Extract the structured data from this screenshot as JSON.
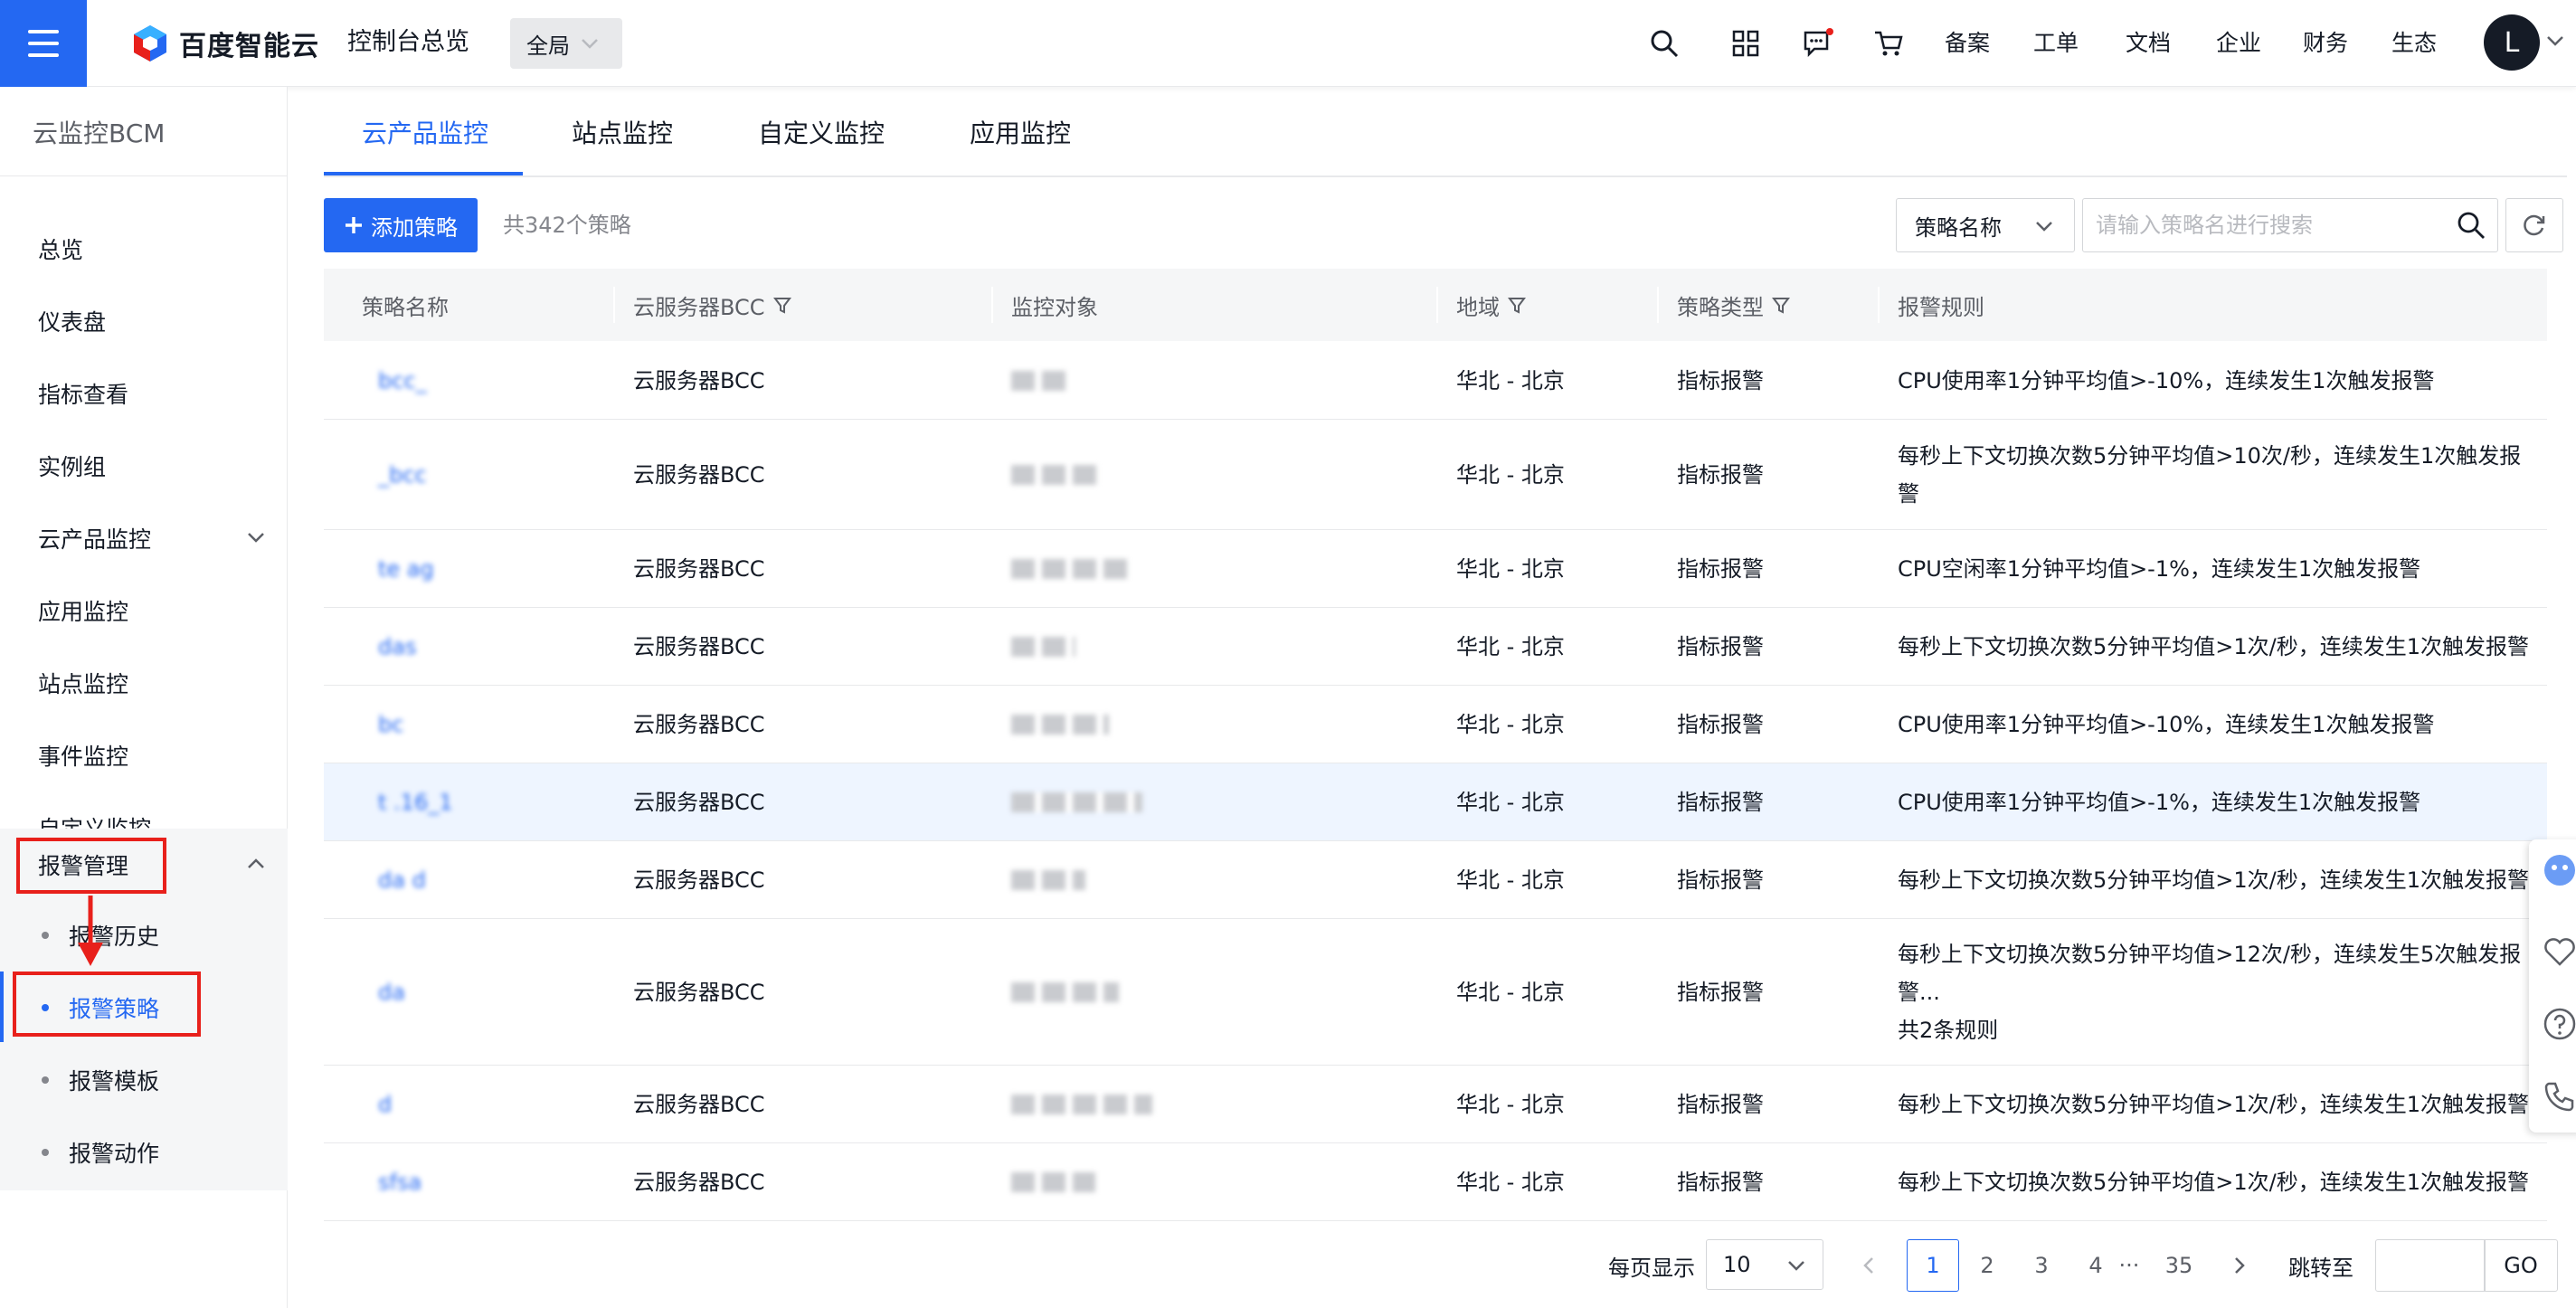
{
  "topbar": {
    "logo_text": "百度智能云",
    "console_title": "控制台总览",
    "region": "全局",
    "links": [
      "备案",
      "工单",
      "文档",
      "企业",
      "财务",
      "生态"
    ],
    "avatar_letter": "L",
    "icons": [
      "search-icon",
      "apps-icon",
      "message-icon",
      "cart-icon"
    ]
  },
  "sidebar": {
    "title": "云监控BCM",
    "items": [
      {
        "label": "总览"
      },
      {
        "label": "仪表盘"
      },
      {
        "label": "指标查看"
      },
      {
        "label": "实例组"
      },
      {
        "label": "云产品监控"
      },
      {
        "label": "应用监控"
      },
      {
        "label": "站点监控"
      },
      {
        "label": "事件监控"
      },
      {
        "label": "自定义监控"
      },
      {
        "label": "报警管理"
      }
    ],
    "subitems": [
      {
        "label": "报警历史"
      },
      {
        "label": "报警策略"
      },
      {
        "label": "报警模板"
      },
      {
        "label": "报警动作"
      }
    ]
  },
  "tabs": [
    "云产品监控",
    "站点监控",
    "自定义监控",
    "应用监控"
  ],
  "toolbar": {
    "add_label": "添加策略",
    "count_text": "共342个策略",
    "filter_label": "策略名称",
    "search_placeholder": "请输入策略名进行搜索"
  },
  "table": {
    "headers": [
      "策略名称",
      "云服务器BCC",
      "监控对象",
      "地域",
      "策略类型",
      "报警规则"
    ],
    "rows": [
      {
        "name": "bcc_",
        "service": "云服务器BCC",
        "object": "",
        "region": "华北 - 北京",
        "type": "指标报警",
        "rule": "CPU使用率1分钟平均值>-10%，连续发生1次触发报警",
        "rule2": "",
        "rule3": ""
      },
      {
        "name": "_bcc",
        "service": "云服务器BCC",
        "object": "",
        "region": "华北 - 北京",
        "type": "指标报警",
        "rule": "每秒上下文切换次数5分钟平均值>10次/秒，连续发生1次触发报",
        "rule2": "警",
        "rule3": ""
      },
      {
        "name": "te ag",
        "service": "云服务器BCC",
        "object": "",
        "region": "华北 - 北京",
        "type": "指标报警",
        "rule": "CPU空闲率1分钟平均值>-1%，连续发生1次触发报警",
        "rule2": "",
        "rule3": ""
      },
      {
        "name": "das",
        "service": "云服务器BCC",
        "object": "",
        "region": "华北 - 北京",
        "type": "指标报警",
        "rule": "每秒上下文切换次数5分钟平均值>1次/秒，连续发生1次触发报警",
        "rule2": "",
        "rule3": ""
      },
      {
        "name": "bc",
        "service": "云服务器BCC",
        "object": "",
        "region": "华北 - 北京",
        "type": "指标报警",
        "rule": "CPU使用率1分钟平均值>-10%，连续发生1次触发报警",
        "rule2": "",
        "rule3": ""
      },
      {
        "name": "t .16_1",
        "service": "云服务器BCC",
        "object": "",
        "region": "华北 - 北京",
        "type": "指标报警",
        "rule": "CPU使用率1分钟平均值>-1%，连续发生1次触发报警",
        "rule2": "",
        "rule3": ""
      },
      {
        "name": "da d",
        "service": "云服务器BCC",
        "object": "",
        "region": "华北 - 北京",
        "type": "指标报警",
        "rule": "每秒上下文切换次数5分钟平均值>1次/秒，连续发生1次触发报警",
        "rule2": "",
        "rule3": ""
      },
      {
        "name": "da",
        "service": "云服务器BCC",
        "object": "",
        "region": "华北 - 北京",
        "type": "指标报警",
        "rule": "每秒上下文切换次数5分钟平均值>12次/秒，连续发生5次触发报",
        "rule2": "警...",
        "rule3": "共2条规则"
      },
      {
        "name": "d",
        "service": "云服务器BCC",
        "object": "",
        "region": "华北 - 北京",
        "type": "指标报警",
        "rule": "每秒上下文切换次数5分钟平均值>1次/秒，连续发生1次触发报警",
        "rule2": "",
        "rule3": ""
      },
      {
        "name": "sfsa",
        "service": "云服务器BCC",
        "object": "",
        "region": "华北 - 北京",
        "type": "指标报警",
        "rule": "每秒上下文切换次数5分钟平均值>1次/秒，连续发生1次触发报警",
        "rule2": "",
        "rule3": ""
      }
    ]
  },
  "pagination": {
    "per_page_label": "每页显示",
    "per_page": "10",
    "pages": [
      "1",
      "2",
      "3",
      "4",
      "···",
      "35"
    ],
    "current": "1",
    "jump_label": "跳转至",
    "go_label": "GO"
  },
  "colors": {
    "accent": "#2468f2",
    "annotation": "#e8201b"
  }
}
